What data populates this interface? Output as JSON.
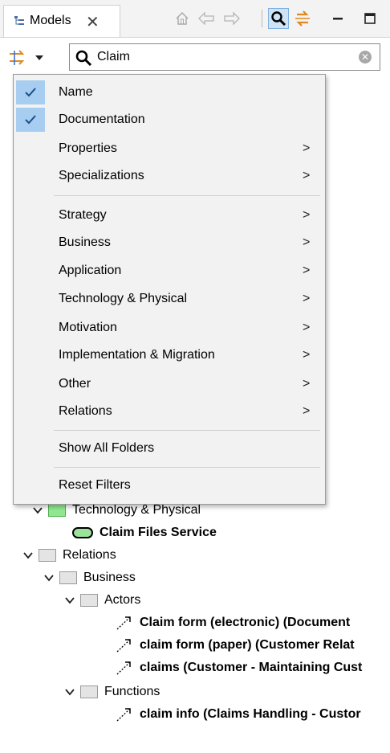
{
  "tab": {
    "label": "Models",
    "close": "✕"
  },
  "search": {
    "value": "Claim"
  },
  "menu": {
    "checked_items": [
      {
        "label": "Name"
      },
      {
        "label": "Documentation"
      }
    ],
    "submenus_a": [
      {
        "label": "Properties",
        "arrow": ">"
      },
      {
        "label": "Specializations",
        "arrow": ">"
      }
    ],
    "submenus_b": [
      {
        "label": "Strategy",
        "arrow": ">"
      },
      {
        "label": "Business",
        "arrow": ">"
      },
      {
        "label": "Application",
        "arrow": ">"
      },
      {
        "label": "Technology & Physical",
        "arrow": ">"
      },
      {
        "label": "Motivation",
        "arrow": ">"
      },
      {
        "label": "Implementation & Migration",
        "arrow": ">"
      },
      {
        "label": "Other",
        "arrow": ">"
      },
      {
        "label": "Relations",
        "arrow": ">"
      }
    ],
    "show_all": "Show All Folders",
    "reset": "Reset Filters"
  },
  "tree": {
    "tech_folder": "Technology & Physical",
    "claim_files_service": "Claim Files Service",
    "relations": "Relations",
    "business": "Business",
    "actors": "Actors",
    "actor_items": [
      "Claim form (electronic) (Document",
      "claim form (paper) (Customer Relat",
      "claims (Customer - Maintaining Cust"
    ],
    "functions": "Functions",
    "function_items": [
      "claim info (Claims Handling - Custor"
    ]
  },
  "colors": {
    "accent": "#a7cdf0",
    "tech_folder": "#8fe88f",
    "folder": "#e4e4e4"
  }
}
